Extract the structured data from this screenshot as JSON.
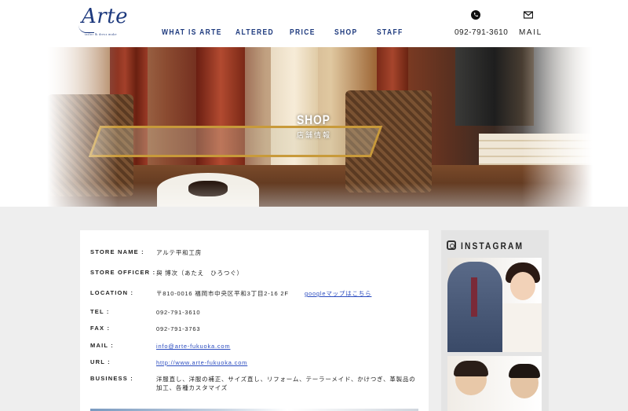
{
  "brand": {
    "logo_text": "Arte",
    "logo_subtitle": "tailor & dress make"
  },
  "nav": {
    "items": [
      {
        "label": "WHAT IS ARTE"
      },
      {
        "label": "ALTERED"
      },
      {
        "label": "PRICE"
      },
      {
        "label": "SHOP"
      },
      {
        "label": "STAFF"
      }
    ]
  },
  "header_contact": {
    "phone": "092-791-3610",
    "mail_label": "MAIL"
  },
  "hero": {
    "title": "SHOP",
    "subtitle": "店舗情報"
  },
  "store_info": {
    "rows": [
      {
        "label": "STORE NAME :",
        "value": "アルテ平和工房"
      },
      {
        "label": "STORE OFFICER :",
        "value": "與 博次（あたえ　ひろつぐ）"
      },
      {
        "label": "LOCATION :",
        "value": "〒810-0016 福岡市中央区平和3丁目2-16 2F",
        "link": "googleマップはこちら"
      },
      {
        "label": "TEL :",
        "value": "092-791-3610"
      },
      {
        "label": "FAX :",
        "value": "092-791-3763"
      },
      {
        "label": "MAIL :",
        "value": "info@arte-fukuoka.com"
      },
      {
        "label": "URL :",
        "value": "http://www.arte-fukuoka.com"
      },
      {
        "label": "BUSINESS :",
        "value": "洋服直し、洋服の補正、サイズ直し、リフォーム、テーラーメイド、かけつぎ、革製品の加工、各種カスタマイズ"
      }
    ]
  },
  "instagram": {
    "title": "INSTAGRAM"
  },
  "colors": {
    "brand_navy": "#1e3a7e",
    "link_blue": "#2a4bbf",
    "page_bg": "#eeeeee"
  }
}
